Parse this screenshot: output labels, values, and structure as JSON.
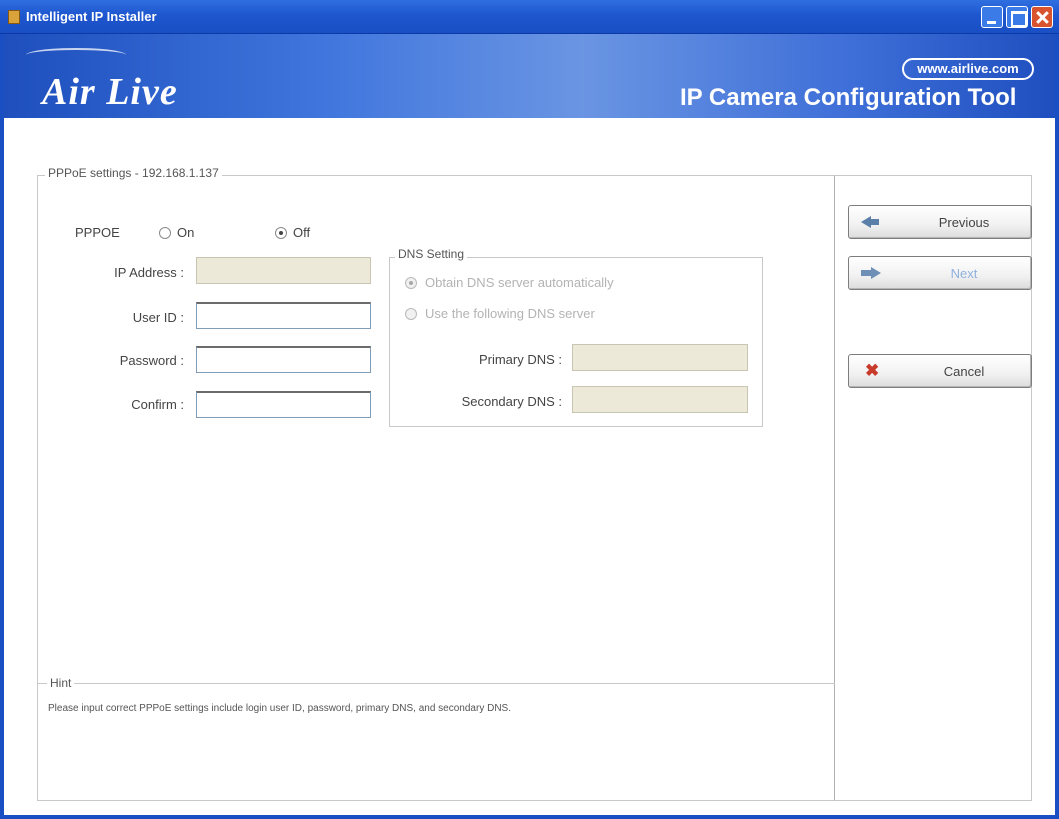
{
  "window": {
    "title": "Intelligent IP Installer"
  },
  "banner": {
    "logo": "Air Live",
    "url": "www.airlive.com",
    "tool_title": "IP Camera Configuration Tool"
  },
  "pppoe_settings": {
    "group_title": "PPPoE settings - 192.168.1.137",
    "pppoe_label": "PPPOE",
    "option_on": "On",
    "option_off": "Off",
    "selected": "Off",
    "ip_address_label": "IP Address :",
    "ip_address_value": "",
    "user_id_label": "User ID :",
    "user_id_value": "",
    "password_label": "Password :",
    "password_value": "",
    "confirm_label": "Confirm :",
    "confirm_value": ""
  },
  "dns_setting": {
    "group_title": "DNS Setting",
    "option_auto": "Obtain DNS server automatically",
    "option_manual": "Use the following DNS server",
    "selected": "auto",
    "primary_dns_label": "Primary DNS :",
    "primary_dns_value": "",
    "secondary_dns_label": "Secondary DNS :",
    "secondary_dns_value": ""
  },
  "buttons": {
    "previous": "Previous",
    "next": "Next",
    "cancel": "Cancel"
  },
  "hint": {
    "label": "Hint",
    "text": "Please input correct PPPoE settings include login user ID, password, primary DNS, and secondary DNS."
  },
  "colors": {
    "titlebar": "#1e56cf",
    "banner": "#3f75dd",
    "disabled_field": "#ece9d8"
  }
}
